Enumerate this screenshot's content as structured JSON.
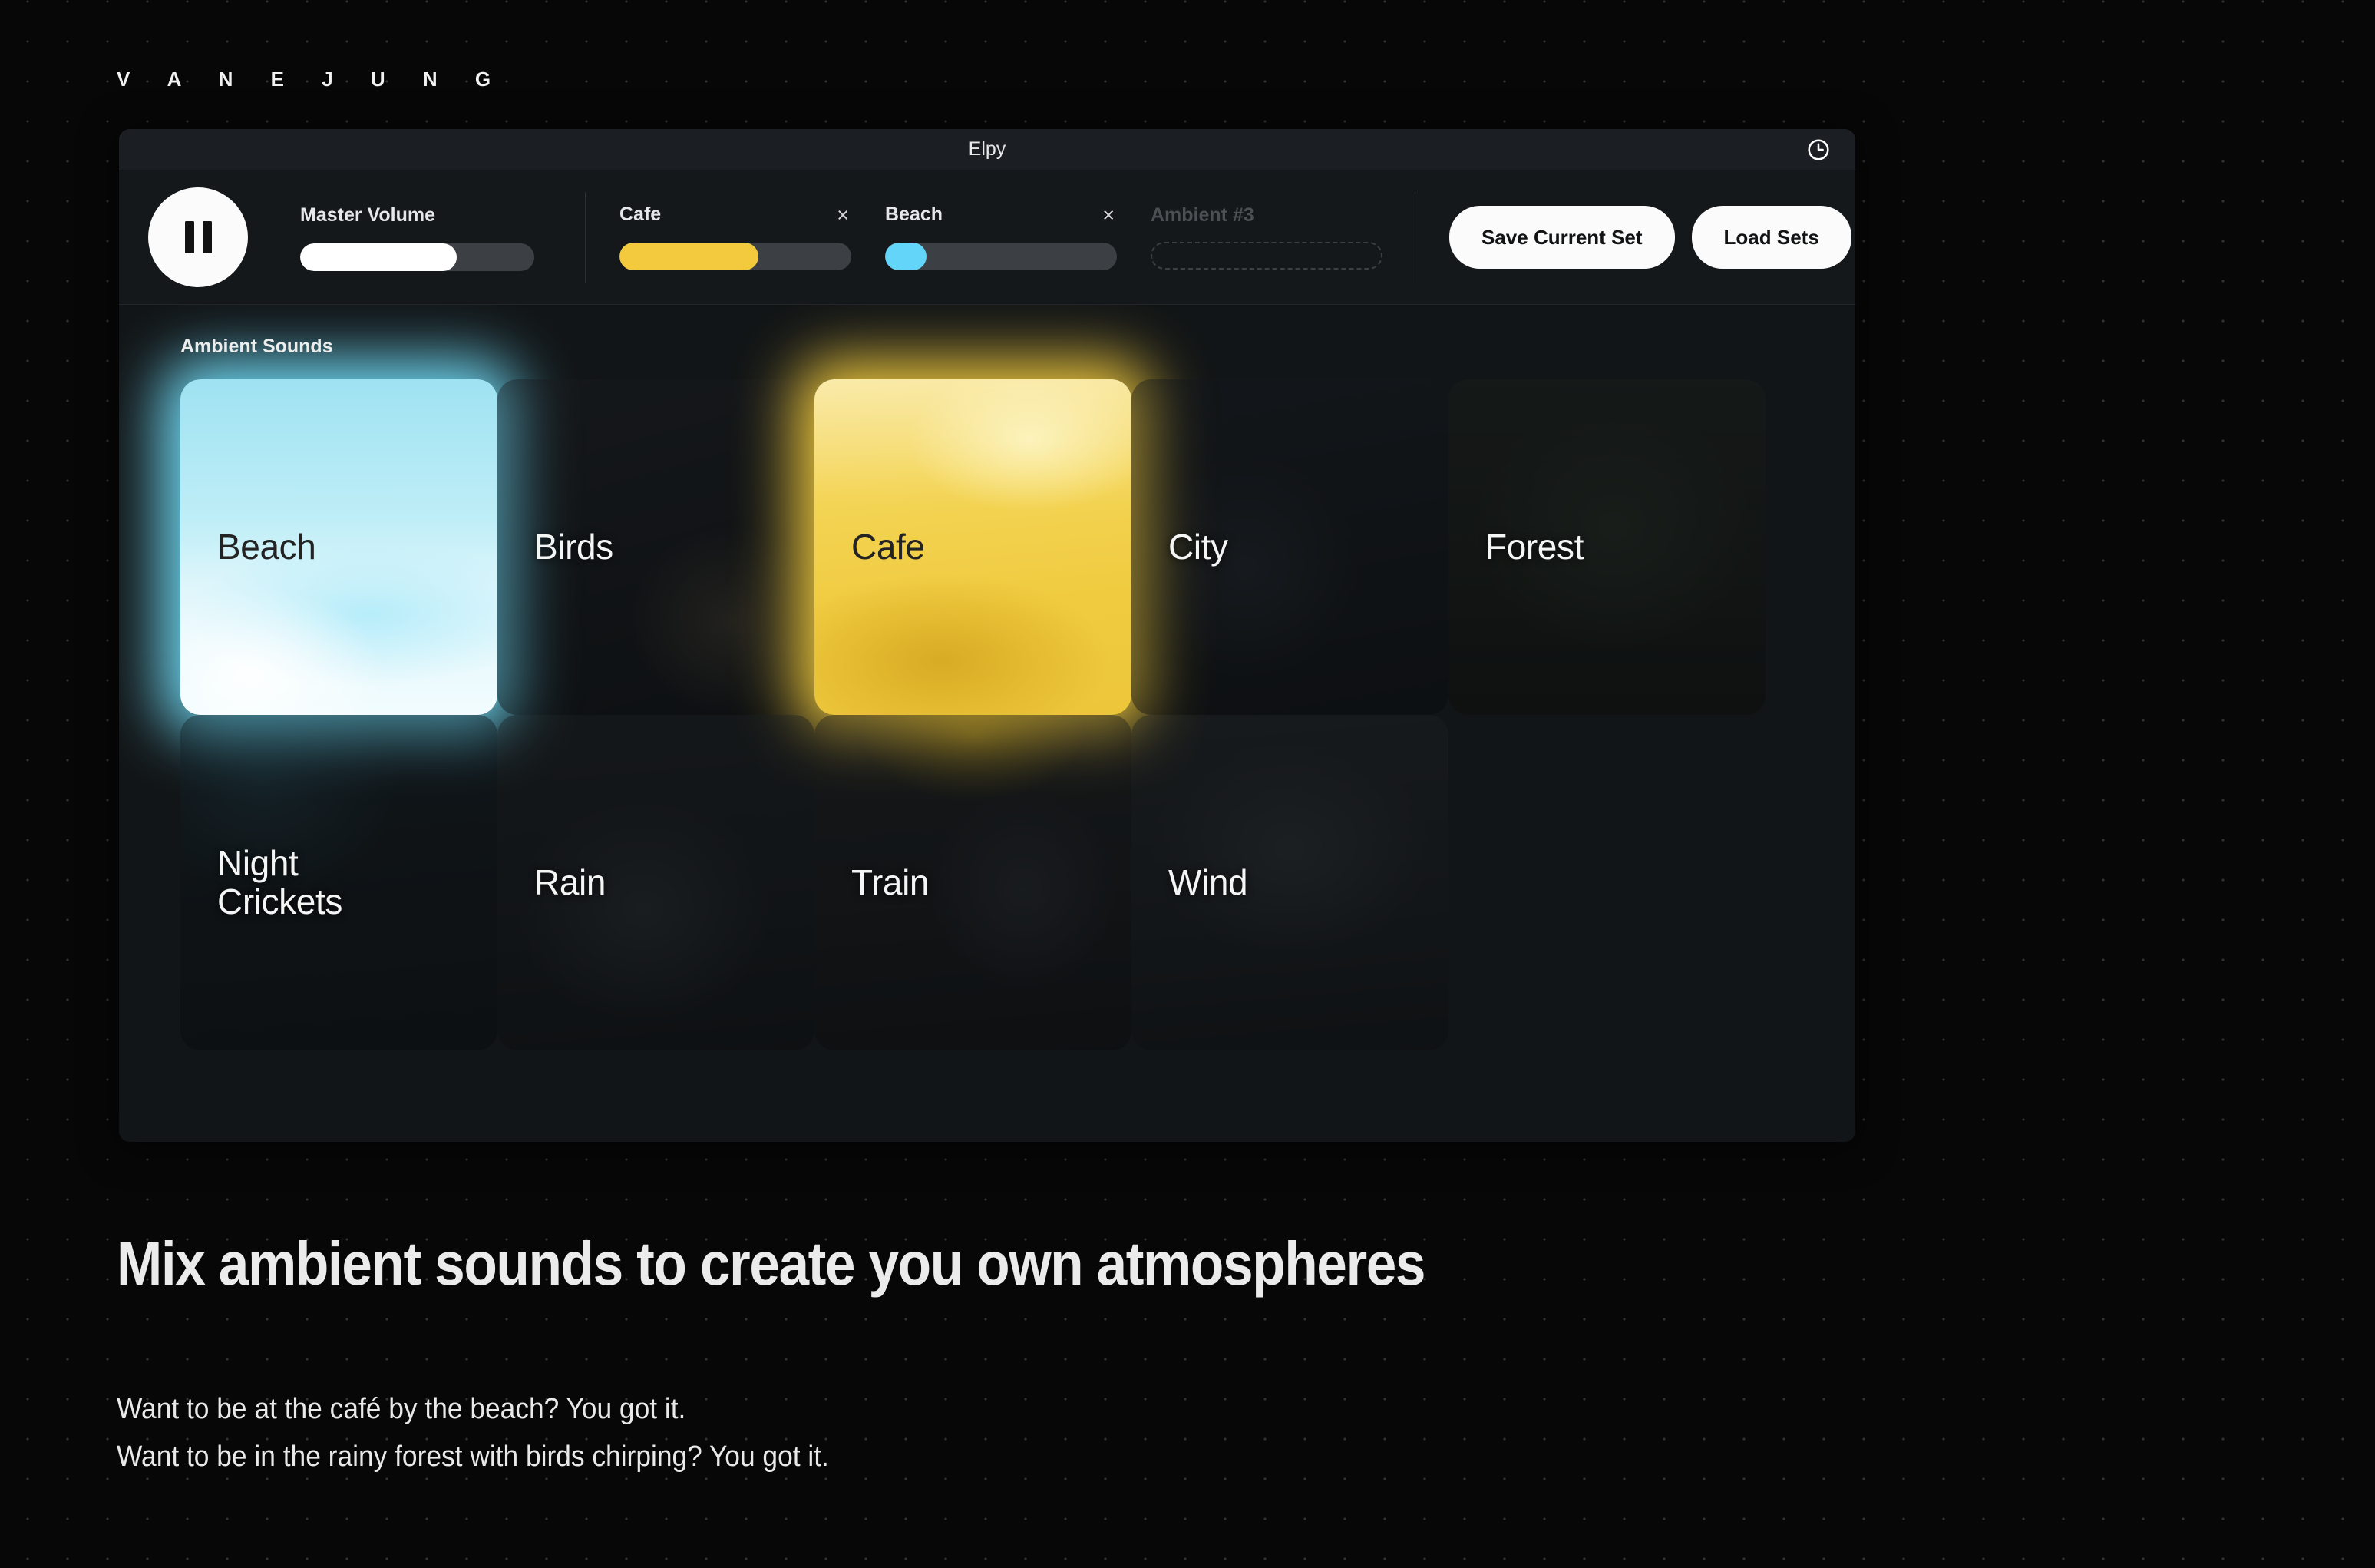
{
  "brand": {
    "name": "V A N E   J U N G"
  },
  "window": {
    "title": "Elpy",
    "clock_icon": "clock-icon"
  },
  "transport": {
    "state_icon": "pause-icon"
  },
  "master": {
    "label": "Master Volume",
    "value_pct": 67
  },
  "channels": [
    {
      "name": "Cafe",
      "value_pct": 60,
      "color": "#f3ca3e",
      "close_label": "×",
      "empty": false
    },
    {
      "name": "Beach",
      "value_pct": 18,
      "color": "#63d5f8",
      "close_label": "×",
      "empty": false
    },
    {
      "name": "Ambient #3",
      "value_pct": 0,
      "color": "#3a3f44",
      "close_label": "",
      "empty": true
    }
  ],
  "actions": {
    "save_label": "Save Current Set",
    "load_label": "Load Sets"
  },
  "library": {
    "section_title": "Ambient Sounds",
    "tiles": [
      {
        "name": "Beach",
        "active": true,
        "art": "art-beach",
        "glow": "#6fd8f2"
      },
      {
        "name": "Birds",
        "active": false,
        "art": "art-birds",
        "glow": "transparent"
      },
      {
        "name": "Cafe",
        "active": true,
        "art": "art-cafe",
        "glow": "#e8c33c"
      },
      {
        "name": "City",
        "active": false,
        "art": "art-city",
        "glow": "transparent"
      },
      {
        "name": "Forest",
        "active": false,
        "art": "art-forest",
        "glow": "transparent"
      },
      {
        "name": "Night Crickets",
        "active": false,
        "art": "art-night",
        "glow": "transparent"
      },
      {
        "name": "Rain",
        "active": false,
        "art": "art-rain",
        "glow": "transparent"
      },
      {
        "name": "Train",
        "active": false,
        "art": "art-train",
        "glow": "transparent"
      },
      {
        "name": "Wind",
        "active": false,
        "art": "art-wind",
        "glow": "transparent"
      }
    ]
  },
  "page": {
    "headline": "Mix ambient sounds to create you own atmospheres",
    "body_line_1": "Want to be at the café by the beach? You got it.",
    "body_line_2": "Want to be in the rainy forest with birds chirping? You got it."
  },
  "colors": {
    "accent_yellow": "#f3ca3e",
    "accent_cyan": "#63d5f8",
    "page_background": "#070707",
    "panel_background": "#161a1d"
  }
}
